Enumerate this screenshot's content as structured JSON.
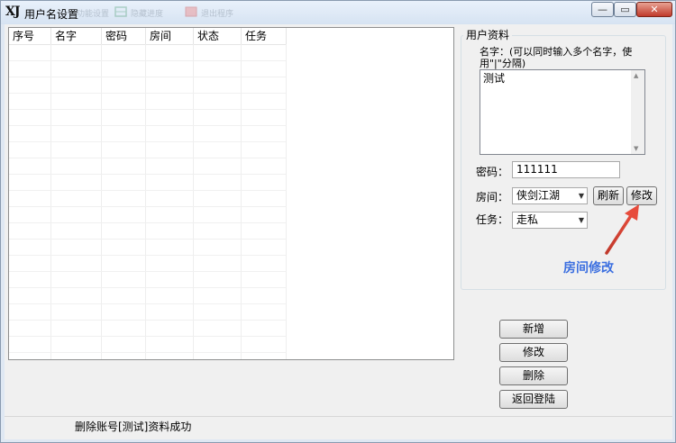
{
  "window": {
    "logo": "XJ",
    "title": "用户名设置",
    "ghost_toolbar": [
      "功能设置",
      "隐藏进度",
      "退出程序"
    ],
    "controls": {
      "minimize": "—",
      "maximize": "▭",
      "close": "✕"
    }
  },
  "list": {
    "columns": [
      "序号",
      "名字",
      "密码",
      "房间",
      "状态",
      "任务"
    ]
  },
  "profile": {
    "group_title": "用户资料",
    "name_hint": "名字：(可以同时输入多个名字，使用\"|\"分隔)",
    "name_value": "测试",
    "password_label": "密码：",
    "password_value": "111111",
    "room_label": "房间：",
    "room_value": "侠剑江湖",
    "refresh_button": "刷新",
    "modify_room_button": "修改",
    "task_label": "任务：",
    "task_value": "走私"
  },
  "annotation": {
    "text": "房间修改",
    "color": "#3b6fe0"
  },
  "actions": {
    "add_button": "新增",
    "modify_button": "修改",
    "delete_button": "删除",
    "back_button": "返回登陆"
  },
  "status": {
    "text": "删除账号[测试]资料成功"
  }
}
